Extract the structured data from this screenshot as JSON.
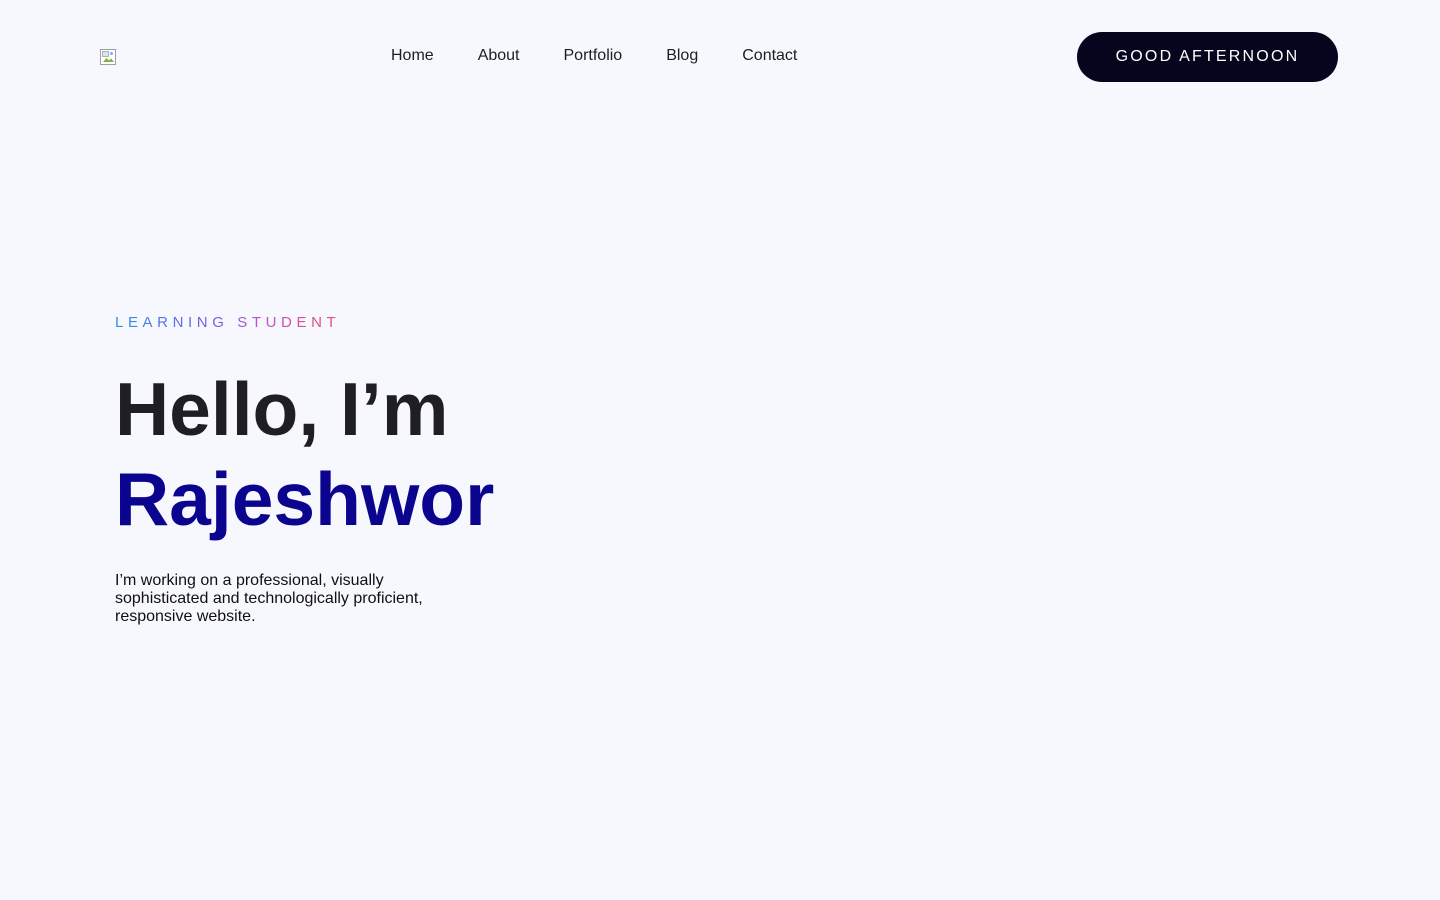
{
  "header": {
    "logo_icon": "broken-image-icon",
    "nav": [
      {
        "label": "Home"
      },
      {
        "label": "About"
      },
      {
        "label": "Portfolio"
      },
      {
        "label": "Blog"
      },
      {
        "label": "Contact"
      }
    ],
    "greeting_button": "GOOD AFTERNOON"
  },
  "hero": {
    "eyebrow": "LEARNING STUDENT",
    "greeting": "Hello, I’m",
    "name": "Rajeshwor",
    "description": "I’m working on a professional, visually sophisticated and technologically proficient, responsive website."
  },
  "colors": {
    "background": "#f7f8fe",
    "button_bg": "#05051e",
    "name_color": "#0a048f",
    "heading_color": "#1e1e23",
    "eyebrow_gradient": [
      "#2f8fe9",
      "#7a5ae6",
      "#c04fc9",
      "#ee4d6e"
    ]
  }
}
